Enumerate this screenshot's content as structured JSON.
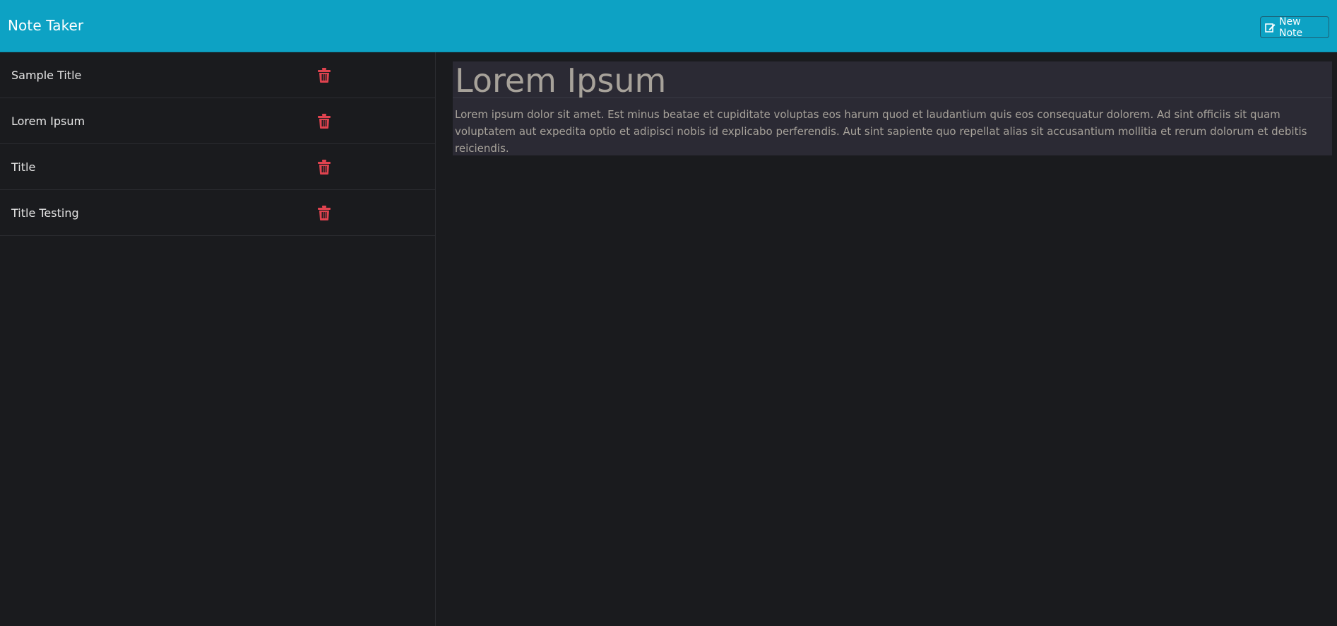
{
  "app": {
    "brand": "Note Taker",
    "new_note_label": "New Note",
    "accent_color": "#0da2c4",
    "delete_color": "#e0434f"
  },
  "sidebar": {
    "items": [
      {
        "title": "Sample Title",
        "icon": "trash-icon"
      },
      {
        "title": "Lorem Ipsum",
        "icon": "trash-icon"
      },
      {
        "title": "Title",
        "icon": "trash-icon"
      },
      {
        "title": "Title Testing",
        "icon": "trash-icon"
      }
    ]
  },
  "editor": {
    "title": "Lorem Ipsum",
    "body": "Lorem ipsum dolor sit amet. Est minus beatae et cupiditate voluptas eos harum quod et laudantium quis eos consequatur dolorem. Ad sint officiis sit quam voluptatem aut expedita optio et adipisci nobis id explicabo perferendis. Aut sint sapiente quo repellat alias sit accusantium mollitia et rerum dolorum et debitis reiciendis."
  }
}
